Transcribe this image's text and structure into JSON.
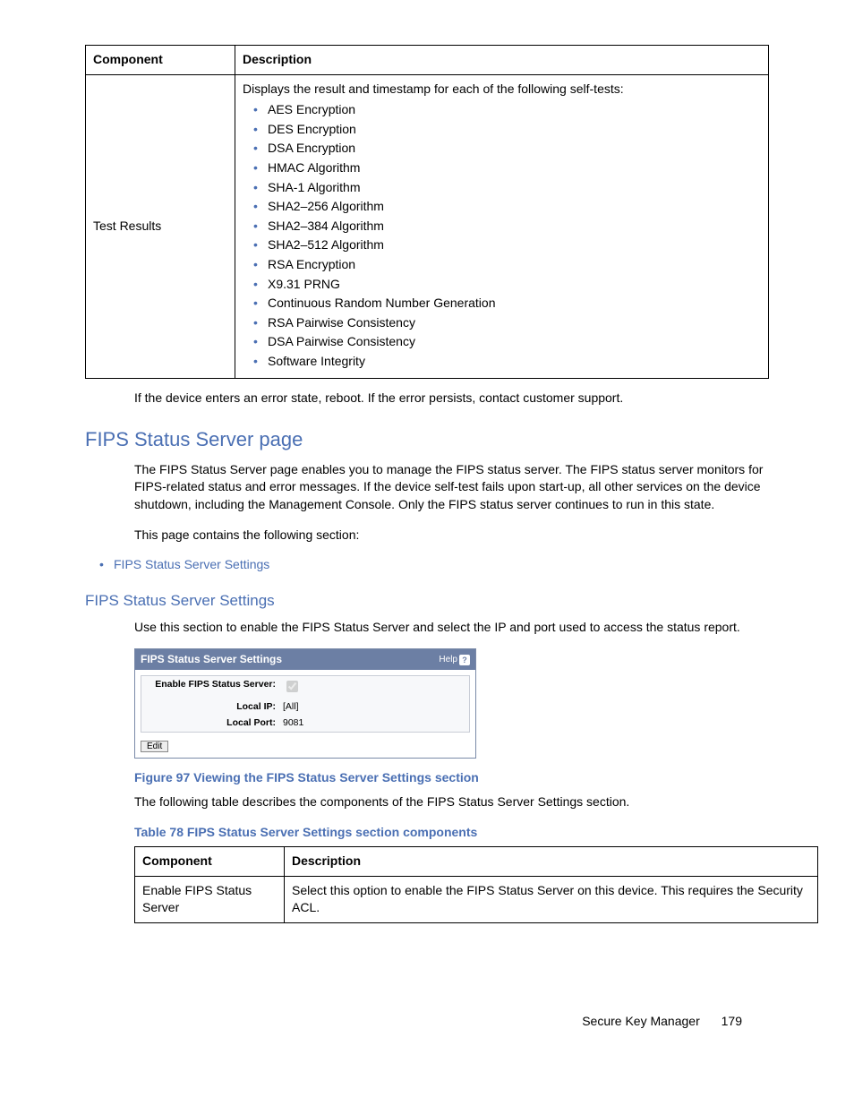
{
  "table1": {
    "headers": {
      "component": "Component",
      "description": "Description"
    },
    "row": {
      "component": "Test Results",
      "intro": "Displays the result and timestamp for each of the following self-tests:",
      "items": [
        "AES Encryption",
        "DES Encryption",
        "DSA Encryption",
        "HMAC Algorithm",
        "SHA-1 Algorithm",
        "SHA2–256 Algorithm",
        "SHA2–384 Algorithm",
        "SHA2–512 Algorithm",
        "RSA Encryption",
        "X9.31 PRNG",
        "Continuous Random Number Generation",
        "RSA Pairwise Consistency",
        "DSA Pairwise Consistency",
        "Software Integrity"
      ]
    }
  },
  "after_table1": "If the device enters an error state, reboot. If the error persists, contact customer support.",
  "section": {
    "title": "FIPS Status Server page",
    "p1": "The FIPS Status Server page enables you to manage the FIPS status server. The FIPS status server monitors for FIPS-related status and error messages. If the device self-test fails upon start-up, all other services on the device shutdown, including the Management Console. Only the FIPS status server continues to run in this state.",
    "p2": "This page contains the following section:",
    "link": "FIPS Status Server Settings"
  },
  "subsection": {
    "title": "FIPS Status Server Settings",
    "p1": "Use this section to enable the FIPS Status Server and select the IP and port used to access the status report."
  },
  "widget": {
    "title": "FIPS Status Server Settings",
    "help": "Help",
    "rows": {
      "enable_label": "Enable FIPS Status Server:",
      "enable_value_checked": true,
      "local_ip_label": "Local IP:",
      "local_ip_value": "[All]",
      "local_port_label": "Local Port:",
      "local_port_value": "9081"
    },
    "edit": "Edit"
  },
  "figure_caption": "Figure 97 Viewing the FIPS Status Server Settings section",
  "after_figure": "The following table describes the components of the FIPS Status Server Settings section.",
  "table2_caption": "Table 78 FIPS Status Server Settings section components",
  "table2": {
    "headers": {
      "component": "Component",
      "description": "Description"
    },
    "row": {
      "component": "Enable FIPS Status Server",
      "description": "Select this option to enable the FIPS Status Server on this device. This requires the Security ACL."
    }
  },
  "footer": {
    "doc": "Secure Key Manager",
    "page": "179"
  }
}
